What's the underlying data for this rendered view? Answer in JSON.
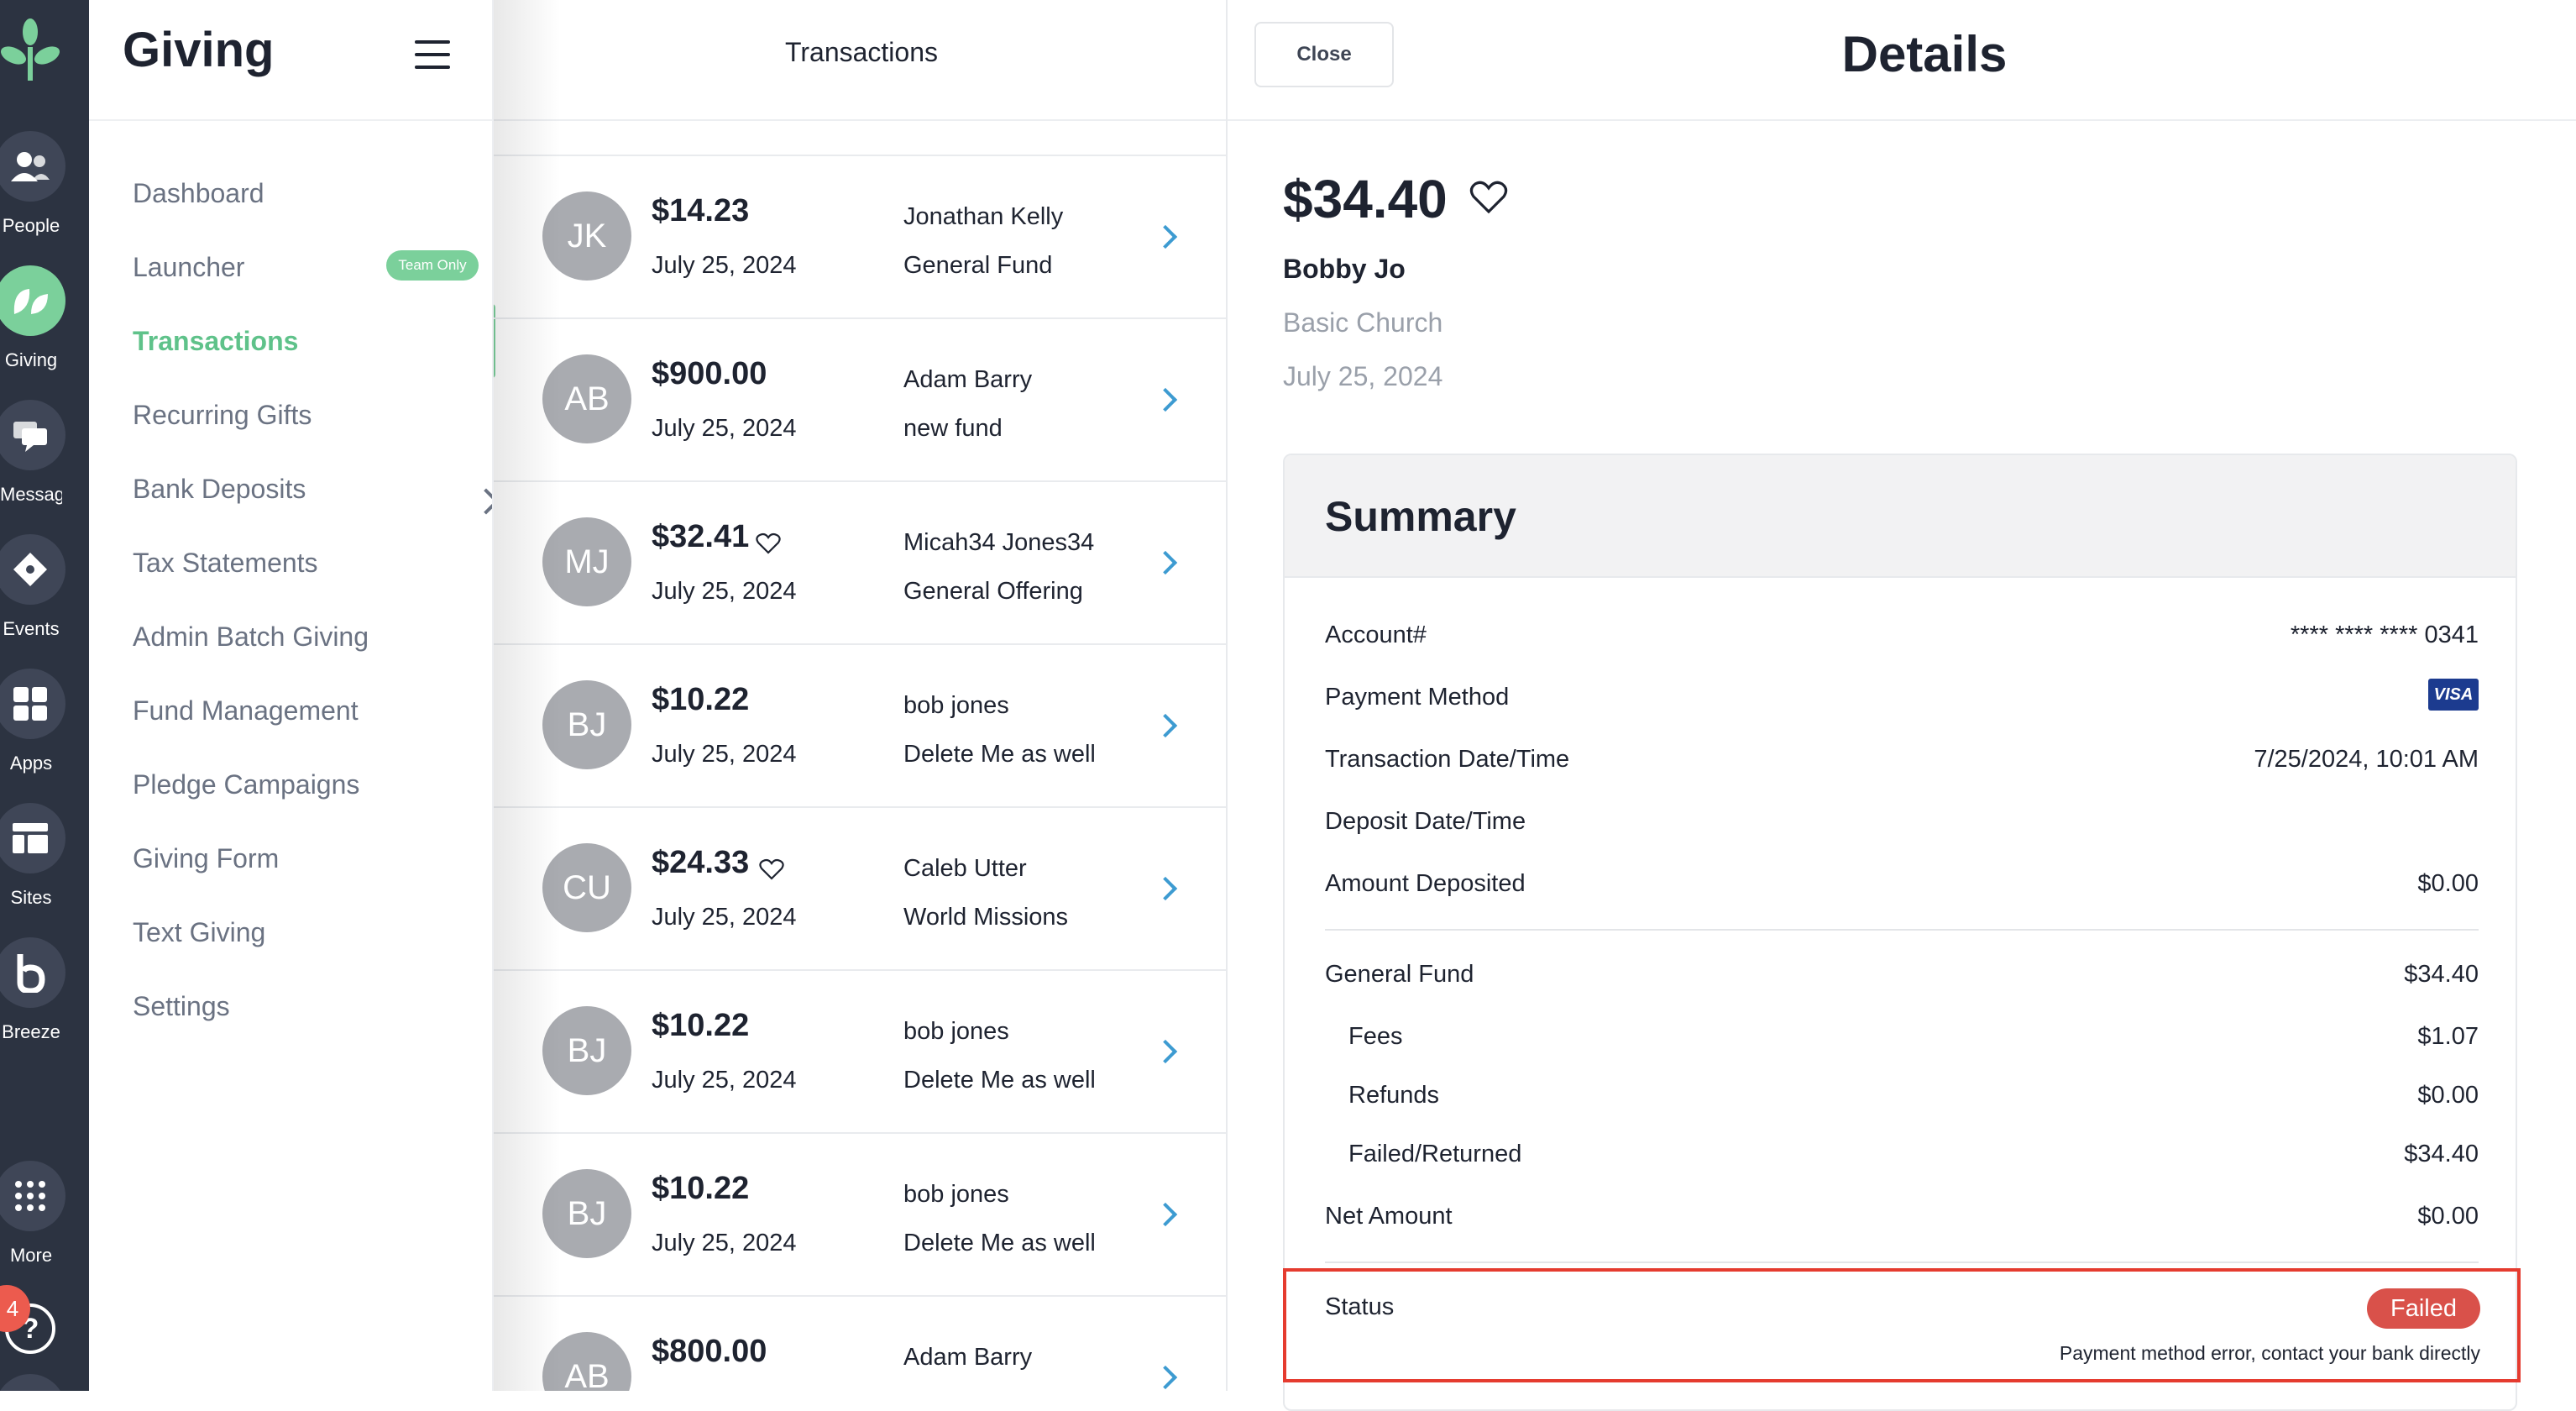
{
  "rail": {
    "items": [
      {
        "label": "People",
        "icon": "people-icon"
      },
      {
        "label": "Giving",
        "icon": "leaf-icon",
        "active": true
      },
      {
        "label": "Messagi...",
        "icon": "chat-icon"
      },
      {
        "label": "Events",
        "icon": "ticket-icon"
      },
      {
        "label": "Apps",
        "icon": "apps-grid-icon"
      },
      {
        "label": "Sites",
        "icon": "layout-icon"
      },
      {
        "label": "Breeze",
        "icon": "breeze-icon"
      },
      {
        "label": "More",
        "icon": "dots-grid-icon"
      }
    ],
    "notification_count": "4",
    "help_glyph": "?"
  },
  "nav": {
    "title": "Giving",
    "team_badge": "Team Only",
    "items": [
      {
        "label": "Dashboard"
      },
      {
        "label": "Launcher"
      },
      {
        "label": "Transactions"
      },
      {
        "label": "Recurring Gifts"
      },
      {
        "label": "Bank Deposits"
      },
      {
        "label": "Tax Statements"
      },
      {
        "label": "Admin Batch Giving"
      },
      {
        "label": "Fund Management"
      },
      {
        "label": "Pledge Campaigns"
      },
      {
        "label": "Giving Form"
      },
      {
        "label": "Text Giving"
      },
      {
        "label": "Settings"
      }
    ]
  },
  "transactions": {
    "title": "Transactions",
    "rows": [
      {
        "initials": "JK",
        "amount": "$14.23",
        "date": "July 25, 2024",
        "name": "Jonathan Kelly",
        "fund": "General Fund",
        "favorite": false
      },
      {
        "initials": "AB",
        "amount": "$900.00",
        "date": "July 25, 2024",
        "name": "Adam Barry",
        "fund": "new fund",
        "favorite": false
      },
      {
        "initials": "MJ",
        "amount": "$32.41",
        "date": "July 25, 2024",
        "name": "Micah34 Jones34",
        "fund": "General Offering",
        "favorite": true
      },
      {
        "initials": "BJ",
        "amount": "$10.22",
        "date": "July 25, 2024",
        "name": "bob jones",
        "fund": "Delete Me as well",
        "favorite": false
      },
      {
        "initials": "CU",
        "amount": "$24.33",
        "date": "July 25, 2024",
        "name": "Caleb Utter",
        "fund": "World Missions",
        "favorite": true
      },
      {
        "initials": "BJ",
        "amount": "$10.22",
        "date": "July 25, 2024",
        "name": "bob jones",
        "fund": "Delete Me as well",
        "favorite": false
      },
      {
        "initials": "BJ",
        "amount": "$10.22",
        "date": "July 25, 2024",
        "name": "bob jones",
        "fund": "Delete Me as well",
        "favorite": false
      },
      {
        "initials": "AB",
        "amount": "$800.00",
        "date": "",
        "name": "Adam Barry",
        "fund": "",
        "favorite": false
      }
    ]
  },
  "details": {
    "close_label": "Close",
    "title": "Details",
    "amount": "$34.40",
    "donor": "Bobby Jo",
    "organization": "Basic Church",
    "date": "July 25, 2024",
    "summary": {
      "title": "Summary",
      "account_label": "Account#",
      "account_value": "**** **** **** 0341",
      "payment_method_label": "Payment Method",
      "payment_method_brand": "VISA",
      "transaction_datetime_label": "Transaction Date/Time",
      "transaction_datetime_value": "7/25/2024, 10:01 AM",
      "deposit_datetime_label": "Deposit Date/Time",
      "deposit_datetime_value": "",
      "amount_deposited_label": "Amount Deposited",
      "amount_deposited_value": "$0.00",
      "fund_label": "General Fund",
      "fund_value": "$34.40",
      "fees_label": "Fees",
      "fees_value": "$1.07",
      "refunds_label": "Refunds",
      "refunds_value": "$0.00",
      "failed_label": "Failed/Returned",
      "failed_value": "$34.40",
      "net_label": "Net Amount",
      "net_value": "$0.00",
      "status_label": "Status",
      "status_value": "Failed",
      "status_message": "Payment method error, contact your bank directly"
    }
  },
  "colors": {
    "rail_bg": "#2c3341",
    "accent_green": "#7bd09b",
    "chevron_blue": "#3d9bd1",
    "failed_red": "#d9514a",
    "highlight_red": "#e53b2f"
  }
}
